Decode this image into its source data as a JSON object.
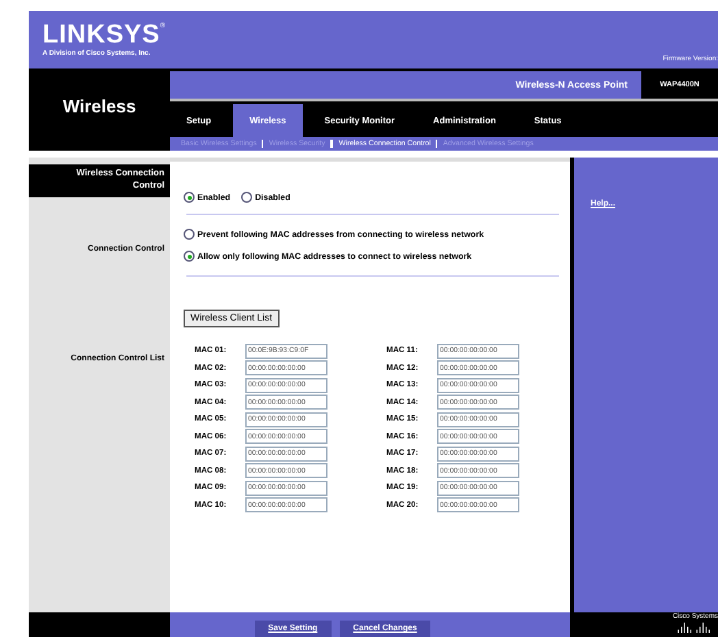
{
  "header": {
    "logo": "LINKSYS",
    "logo_mark": "®",
    "logo_subtitle": "A Division of Cisco Systems, Inc.",
    "firmware": "Firmware Version:"
  },
  "product_bar": {
    "product_name": "Wireless-N Access Point",
    "model": "WAP4400N"
  },
  "section_title": "Wireless",
  "tabs": [
    {
      "label": "Setup",
      "selected": false
    },
    {
      "label": "Wireless",
      "selected": true
    },
    {
      "label": "Security Monitor",
      "selected": false
    },
    {
      "label": "Administration",
      "selected": false
    },
    {
      "label": "Status",
      "selected": false
    }
  ],
  "subtabs": [
    {
      "label": "Basic Wireless Settings",
      "selected": false
    },
    {
      "label": "Wireless Security",
      "selected": false
    },
    {
      "label": "Wireless Connection Control",
      "selected": true
    },
    {
      "label": "Advanced Wireless Settings",
      "selected": false
    }
  ],
  "form": {
    "section_heading": "Wireless Connection Control",
    "status_options": [
      {
        "label": "Enabled",
        "selected": true
      },
      {
        "label": "Disabled",
        "selected": false
      }
    ],
    "connection_control_label": "Connection Control",
    "control_options": [
      {
        "label": "Prevent following MAC addresses from connecting to wireless network",
        "selected": false
      },
      {
        "label": "Allow only following MAC addresses to connect to wireless network",
        "selected": true
      }
    ],
    "client_list_button": "Wireless Client List",
    "list_label": "Connection Control List",
    "macs": [
      {
        "label": "MAC 01:",
        "value": "00:0E:9B:93:C9:0F"
      },
      {
        "label": "MAC 02:",
        "value": "00:00:00:00:00:00"
      },
      {
        "label": "MAC 03:",
        "value": "00:00:00:00:00:00"
      },
      {
        "label": "MAC 04:",
        "value": "00:00:00:00:00:00"
      },
      {
        "label": "MAC 05:",
        "value": "00:00:00:00:00:00"
      },
      {
        "label": "MAC 06:",
        "value": "00:00:00:00:00:00"
      },
      {
        "label": "MAC 07:",
        "value": "00:00:00:00:00:00"
      },
      {
        "label": "MAC 08:",
        "value": "00:00:00:00:00:00"
      },
      {
        "label": "MAC 09:",
        "value": "00:00:00:00:00:00"
      },
      {
        "label": "MAC 10:",
        "value": "00:00:00:00:00:00"
      },
      {
        "label": "MAC 11:",
        "value": "00:00:00:00:00:00"
      },
      {
        "label": "MAC 12:",
        "value": "00:00:00:00:00:00"
      },
      {
        "label": "MAC 13:",
        "value": "00:00:00:00:00:00"
      },
      {
        "label": "MAC 14:",
        "value": "00:00:00:00:00:00"
      },
      {
        "label": "MAC 15:",
        "value": "00:00:00:00:00:00"
      },
      {
        "label": "MAC 16:",
        "value": "00:00:00:00:00:00"
      },
      {
        "label": "MAC 17:",
        "value": "00:00:00:00:00:00"
      },
      {
        "label": "MAC 18:",
        "value": "00:00:00:00:00:00"
      },
      {
        "label": "MAC 19:",
        "value": "00:00:00:00:00:00"
      },
      {
        "label": "MAC 20:",
        "value": "00:00:00:00:00:00"
      }
    ]
  },
  "help_link": "Help...",
  "buttons": [
    "Save Setting",
    "Cancel Changes"
  ],
  "footer_logo": "Cisco Systems"
}
